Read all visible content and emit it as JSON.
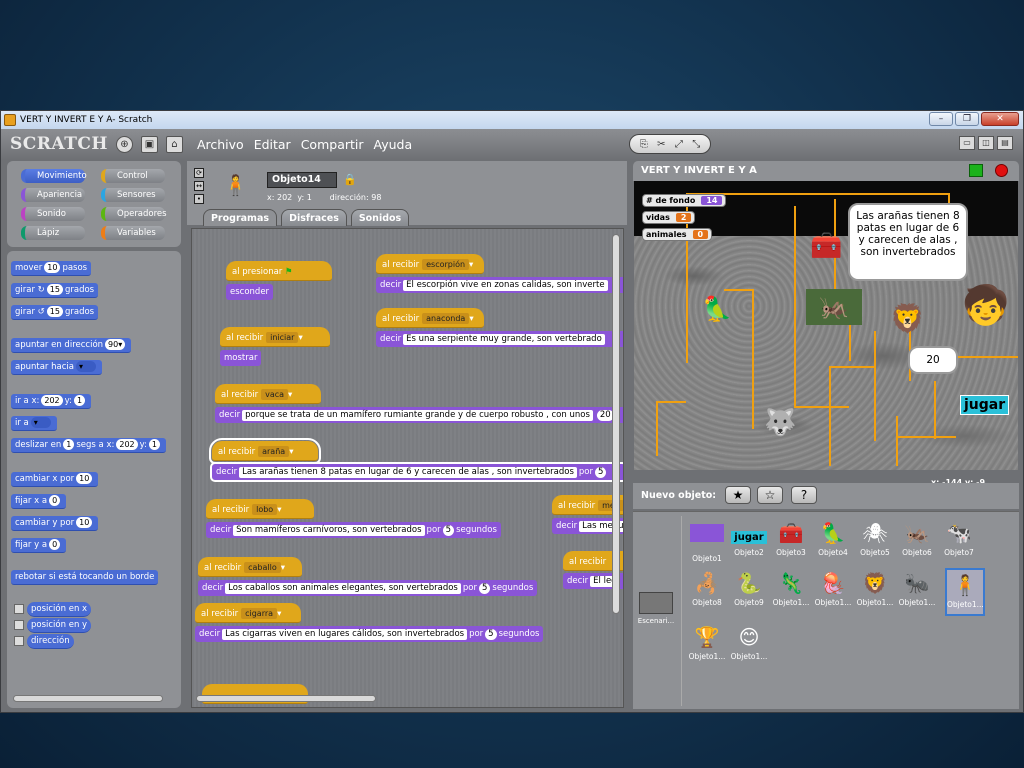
{
  "window": {
    "title": "VERT Y INVERT E Y A- Scratch"
  },
  "menubar": {
    "logo": "SCRATCH",
    "items": [
      "Archivo",
      "Editar",
      "Compartir",
      "Ayuda"
    ]
  },
  "categories": [
    {
      "label": "Movimiento",
      "color": "#4a6cd4"
    },
    {
      "label": "Control",
      "color": "#e0a71b"
    },
    {
      "label": "Apariencia",
      "color": "#8a55d7"
    },
    {
      "label": "Sensores",
      "color": "#2ca5e2"
    },
    {
      "label": "Sonido",
      "color": "#bb42c3"
    },
    {
      "label": "Operadores",
      "color": "#5cb712"
    },
    {
      "label": "Lápiz",
      "color": "#0e9a6c"
    },
    {
      "label": "Variables",
      "color": "#ee7d16"
    }
  ],
  "palette": {
    "mover": {
      "a": "mover",
      "n": "10",
      "b": "pasos"
    },
    "girar1": {
      "a": "girar ↻",
      "n": "15",
      "b": "grados"
    },
    "girar2": {
      "a": "girar ↺",
      "n": "15",
      "b": "grados"
    },
    "apuntar": {
      "a": "apuntar en dirección",
      "n": "90▾"
    },
    "apuntar_hacia": {
      "a": "apuntar hacia"
    },
    "ira": {
      "a": "ir a x:",
      "x": "202",
      "b": "y:",
      "y": "1"
    },
    "ira2": {
      "a": "ir a"
    },
    "deslizar": {
      "a": "deslizar en",
      "n": "1",
      "b": "segs a x:",
      "x": "202",
      "c": "y:",
      "y": "1"
    },
    "cambiarx": {
      "a": "cambiar x por",
      "n": "10"
    },
    "fijarx": {
      "a": "fijar x a",
      "n": "0"
    },
    "cambiary": {
      "a": "cambiar y por",
      "n": "10"
    },
    "fijary": {
      "a": "fijar y a",
      "n": "0"
    },
    "rebotar": "rebotar si está tocando un borde",
    "posx": "posición en x",
    "posy": "posición en y",
    "direccion": "dirección"
  },
  "sprite": {
    "name": "Objeto14",
    "x_label": "x:",
    "x": "202",
    "y_label": "y:",
    "y": "1",
    "dir_label": "dirección:",
    "dir": "98"
  },
  "tabs": [
    "Programas",
    "Disfraces",
    "Sonidos"
  ],
  "scripts": {
    "flag": {
      "hat": "al presionar",
      "say": "esconder"
    },
    "iniciar": {
      "hat": "al recibir",
      "msg": "iniciar",
      "say": "mostrar"
    },
    "vaca": {
      "hat": "al recibir",
      "msg": "vaca",
      "say": "decir",
      "text": "porque se trata de un mamífero rumiante grande y de cuerpo robusto , con unos",
      "n": "20"
    },
    "arana": {
      "hat": "al recibir",
      "msg": "araña",
      "say": "decir",
      "text": "Las arañas tienen 8 patas en lugar de 6 y carecen de alas , son invertebrados",
      "por": "por",
      "n": "5"
    },
    "lobo": {
      "hat": "al recibir",
      "msg": "lobo",
      "say": "decir",
      "text": "Son mamíferos carnívoros, son vertebrados",
      "por": "por",
      "n": "5",
      "seg": "segundos"
    },
    "caballo": {
      "hat": "al recibir",
      "msg": "caballo",
      "say": "decir",
      "text": "Los caballos son animales elegantes, son vertebrados",
      "por": "por",
      "n": "5",
      "seg": "segundos"
    },
    "cigarra": {
      "hat": "al recibir",
      "msg": "cigarra",
      "say": "decir",
      "text": "Las cigarras viven en lugares cálidos, son invertebrados",
      "por": "por",
      "n": "5",
      "seg": "segundos"
    },
    "escorpion": {
      "hat": "al recibir",
      "msg": "escorpión",
      "say": "decir",
      "text": "El escorpión vive en zonas calidas, son inverte"
    },
    "anaconda": {
      "hat": "al recibir",
      "msg": "anaconda",
      "say": "decir",
      "text": "Es una serpiente muy grande, son vertebrado"
    },
    "med": {
      "hat": "al recibir",
      "msg": "med",
      "say": "decir",
      "text": "Las medu"
    },
    "le": {
      "hat": "al recibir",
      "say": "decir",
      "text": "El leo"
    }
  },
  "stage": {
    "title": "VERT Y INVERT E Y A",
    "monitors": [
      {
        "label": "# de fondo",
        "value": "14"
      },
      {
        "label": "vidas",
        "value": "2"
      },
      {
        "label": "animales",
        "value": "0"
      }
    ],
    "bubble": "Las arañas tienen 8 patas en lugar de 6 y carecen de alas , son invertebrados",
    "bubble2": "20",
    "jugar": "jugar",
    "coords": "x: -144  y: -9"
  },
  "newobj_label": "Nuevo objeto:",
  "stage_thumb": "Escenari...",
  "objects": [
    "Objeto1",
    "Objeto2",
    "Objeto3",
    "Objeto4",
    "Objeto5",
    "Objeto6",
    "Objeto7",
    "Objeto8",
    "Objeto9",
    "Objeto1...",
    "Objeto1...",
    "Objeto1...",
    "Objeto1...",
    "Objeto1...",
    "Objeto1...",
    "Objeto1..."
  ],
  "obj2_label": "jugar"
}
